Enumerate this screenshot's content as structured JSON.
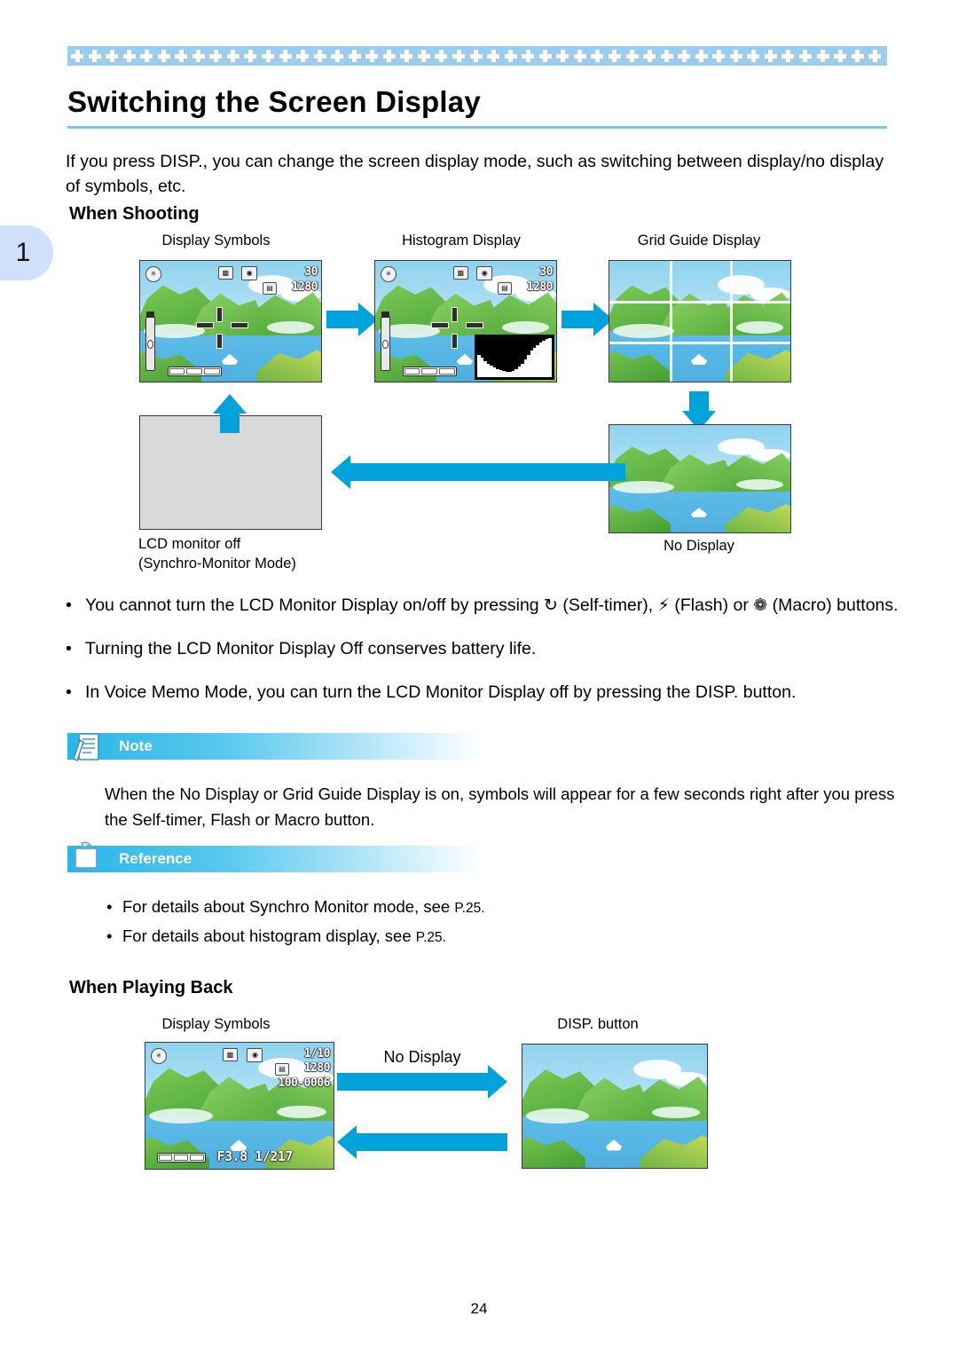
{
  "chapter": {
    "number": "1"
  },
  "header": {
    "title": "Switching the Screen Display",
    "intro": "If you press DISP., you can change the screen display mode, such as switching between display/no display of symbols, etc."
  },
  "sections": {
    "shooting": {
      "heading": "When Shooting",
      "labels": {
        "display_symbols": "Display Symbols",
        "histogram_display": "Histogram Display",
        "grid_guide_display": "Grid Guide Display",
        "lcd_off_line1": "LCD monitor off",
        "lcd_off_line2": "(Synchro-Monitor Mode)",
        "no_display": "No Display"
      },
      "osd": {
        "mode_number": "30",
        "resolution": "1280",
        "flash_icon": "flash-off-icon",
        "macro_icon": "macro-icon",
        "camera_icon": "camera-mode-icon",
        "card_icon": "memory-card-icon"
      }
    },
    "playback": {
      "heading": "When Playing Back",
      "labels": {
        "display_symbols": "Display Symbols",
        "no_display": "No Display",
        "disp_button": "DISP. button"
      },
      "osd": {
        "frame_counter": "1/10",
        "resolution": "1280",
        "file_number": "100-0006",
        "exposure": "F3.8 1/217"
      }
    }
  },
  "bullets": [
    {
      "part1": "You cannot turn the LCD Monitor Display on/off by pressing ",
      "icon1": "↻",
      "part2": " (Self-timer), ",
      "icon2": "⚡",
      "part3": " (Flash) or ",
      "icon3": "❁",
      "part4": " (Macro) buttons."
    },
    {
      "part1": "Turning the LCD Monitor Display Off conserves battery life."
    },
    {
      "part1": "In Voice Memo Mode, you can turn the LCD Monitor Display off by pressing the DISP. button."
    }
  ],
  "note": {
    "title": "Note",
    "icon": "note-document-icon",
    "body": "When the No Display or Grid Guide Display is on, symbols will appear for a few seconds right after you press the Self-timer, Flash or Macro button."
  },
  "reference": {
    "title": "Reference",
    "icon": "reference-folder-icon",
    "items": [
      {
        "text": "For details about Synchro Monitor mode, see ",
        "page": "P.25."
      },
      {
        "text": "For details about histogram display, see ",
        "page": "P.25."
      }
    ]
  },
  "footer": {
    "page_number": "24"
  },
  "colors": {
    "accent": "#00a2dc",
    "band": "#9ccdee",
    "rule": "#6fcbe8",
    "tab": "#cfe0fa"
  }
}
